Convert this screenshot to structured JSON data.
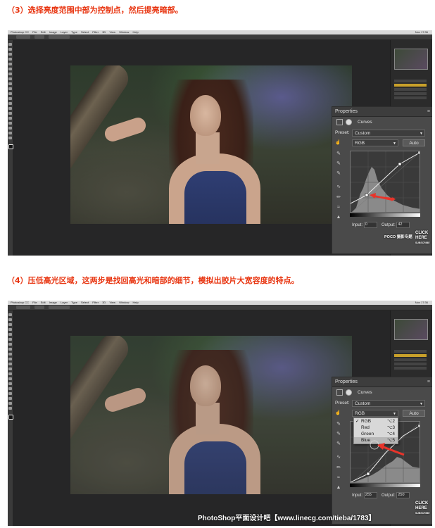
{
  "step3": {
    "text": "（3）选择亮度范围中部为控制点，然后提亮暗部。"
  },
  "step4": {
    "text": "（4）压低高光区域，这两步是找回高光和暗部的细节，模拟出胶片大宽容度的特点。"
  },
  "app": {
    "name": "Photoshop CC",
    "menu": [
      "File",
      "Edit",
      "Image",
      "Layer",
      "Type",
      "Select",
      "Filter",
      "3D",
      "View",
      "Window",
      "Help"
    ],
    "clock": "Nov 17:36"
  },
  "properties": {
    "title": "Properties",
    "panel_name": "Curves",
    "preset_label": "Preset:",
    "preset_value": "Custom",
    "auto_label": "Auto",
    "input_label": "Input:",
    "output_label": "Output:"
  },
  "shot1": {
    "channel": "RGB",
    "input_value": "0",
    "output_value": "42"
  },
  "shot2": {
    "channel": "RGB",
    "input_value": "255",
    "output_value": "250",
    "channel_menu": [
      {
        "label": "RGB",
        "shortcut": "⌥2",
        "checked": true
      },
      {
        "label": "Red",
        "shortcut": "⌥3",
        "checked": false
      },
      {
        "label": "Green",
        "shortcut": "⌥4",
        "checked": false
      },
      {
        "label": "Blue",
        "shortcut": "⌥5",
        "checked": false
      }
    ]
  },
  "watermarks": {
    "poco": "POCO 摄影专题",
    "click": "CLICK",
    "here": "HERE",
    "subscribe": "SUBSCRIBE",
    "footer": "PhotoShop平面设计吧【www.linecg.com/tieba/1783】"
  },
  "colors": {
    "step_text": "#e8340f",
    "arrow": "#e8342a",
    "layer_highlight": "#c8a02a"
  }
}
